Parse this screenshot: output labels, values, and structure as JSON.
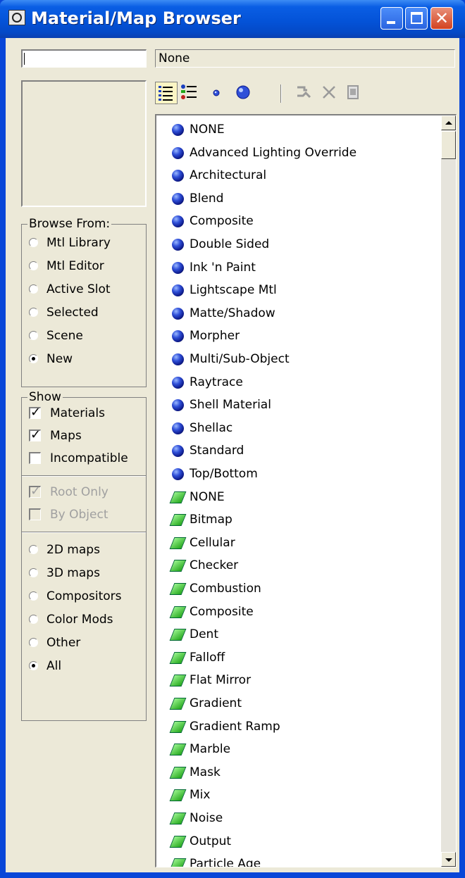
{
  "window": {
    "title": "Material/Map Browser",
    "title_icon": "app-logo-icon"
  },
  "name_field": {
    "value": ""
  },
  "type_field": {
    "value": "None"
  },
  "toolbar": {
    "icons": [
      "view-list-icon",
      "view-list-icons-icon",
      "view-small-icons-icon",
      "view-large-icons-icon",
      "update-scene-materials-icon",
      "delete-from-library-icon",
      "clear-material-library-icon"
    ],
    "active_index": 0
  },
  "browse_from": {
    "legend": "Browse From:",
    "options": [
      "Mtl Library",
      "Mtl Editor",
      "Active Slot",
      "Selected",
      "Scene",
      "New"
    ],
    "selected": "New"
  },
  "show": {
    "legend": "Show",
    "materials": {
      "label": "Materials",
      "checked": true
    },
    "maps": {
      "label": "Maps",
      "checked": true
    },
    "incompatible": {
      "label": "Incompatible",
      "checked": false
    },
    "root_only": {
      "label": "Root Only",
      "checked": true,
      "disabled": true
    },
    "by_object": {
      "label": "By Object",
      "checked": false,
      "disabled": true
    },
    "map_types": [
      "2D maps",
      "3D maps",
      "Compositors",
      "Color Mods",
      "Other",
      "All"
    ],
    "map_type_selected": "All"
  },
  "list": {
    "materials": [
      "NONE",
      "Advanced Lighting Override",
      "Architectural",
      "Blend",
      "Composite",
      "Double Sided",
      "Ink 'n Paint",
      "Lightscape Mtl",
      "Matte/Shadow",
      "Morpher",
      "Multi/Sub-Object",
      "Raytrace",
      "Shell Material",
      "Shellac",
      "Standard",
      "Top/Bottom"
    ],
    "maps": [
      "NONE",
      "Bitmap",
      "Cellular",
      "Checker",
      "Combustion",
      "Composite",
      "Dent",
      "Falloff",
      "Flat Mirror",
      "Gradient",
      "Gradient Ramp",
      "Marble",
      "Mask",
      "Mix",
      "Noise",
      "Output",
      "Particle Age"
    ],
    "material_icon": "material-sphere-icon",
    "map_icon": "map-parallelogram-icon"
  },
  "colors": {
    "titlebar": "#0453d8",
    "client_bg": "#ece9d8",
    "close_button": "#d3421f",
    "material_icon": "#2f4fd8",
    "map_icon": "#22a61a"
  }
}
